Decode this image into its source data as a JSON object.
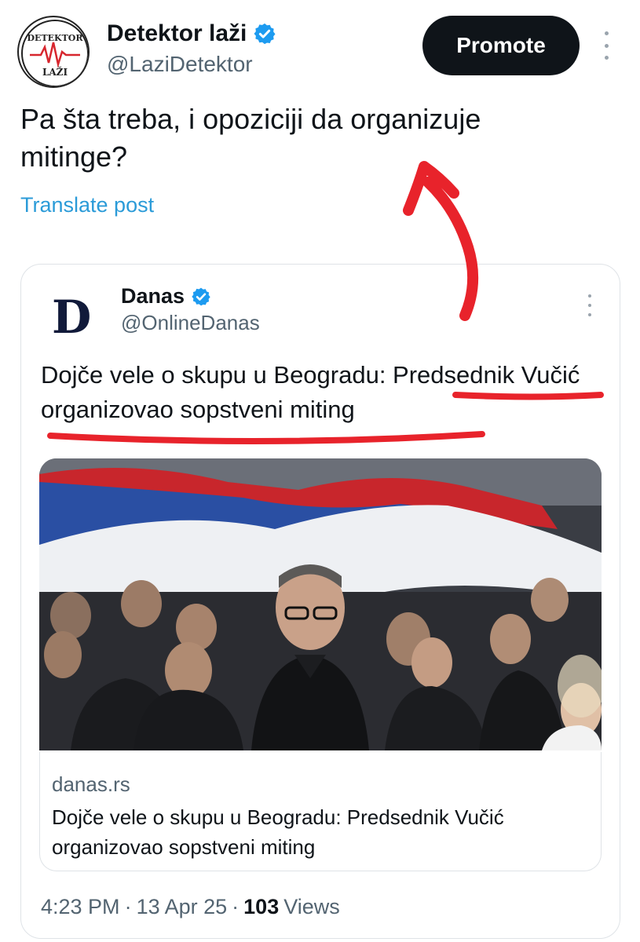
{
  "post": {
    "display_name": "Detektor laži",
    "handle": "@LaziDetektor",
    "avatar_text_top": "DETEKTOR",
    "avatar_text_bottom": "LAŽI",
    "promote_label": "Promote",
    "text": "Pa šta treba, i opoziciji da organizuje mitinge?",
    "translate_label": "Translate post"
  },
  "quote": {
    "logo_letter": "D",
    "display_name": "Danas",
    "handle": "@OnlineDanas",
    "text": "Dojče vele o skupu u Beogradu: Predsednik Vučić organizovao sopstveni miting",
    "link_domain": "danas.rs",
    "link_title": "Dojče vele o skupu u Beogradu: Predsednik Vučić organizovao sopstveni miting"
  },
  "meta": {
    "time": "4:23 PM",
    "sep1": "·",
    "date": "13 Apr 25",
    "sep2": "·",
    "views_count": "103",
    "views_label": "Views"
  },
  "colors": {
    "verified_blue": "#1d9bf0",
    "link_blue": "#2b9bd8",
    "annotation_red": "#e8232b"
  }
}
